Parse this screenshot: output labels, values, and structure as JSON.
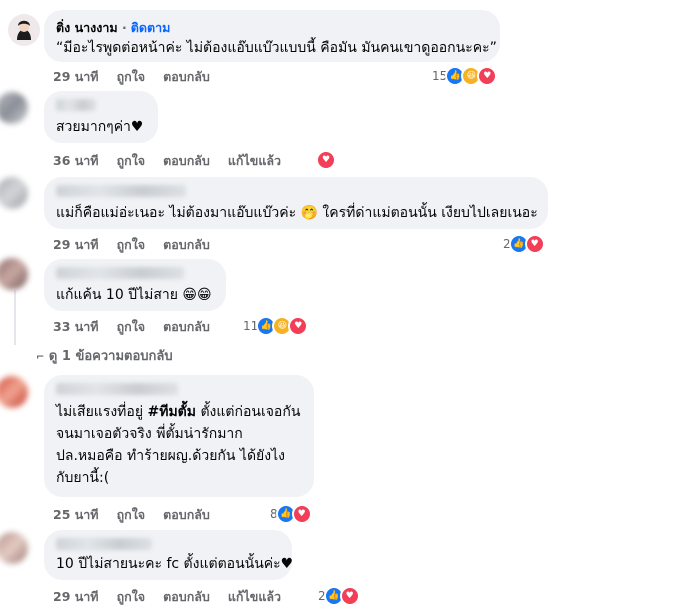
{
  "comments": [
    {
      "author": "ติ่ง นางงาม",
      "follow_label": "ติดตาม",
      "text": [
        "“มีอะไรพูดต่อหน้าค่ะ ไม่ต้องแอ๊บแบ๊วแบบนี้ คือมัน มันคนเขาดูออกนะคะ”"
      ],
      "time": "29 นาที",
      "like_label": "ถูกใจ",
      "reply_label": "ตอบกลับ",
      "reaction_count": "15",
      "reactions": [
        "like-icon",
        "haha-icon",
        "love-icon"
      ]
    },
    {
      "text": [
        "สวยมากๆค่า♥"
      ],
      "time": "36 นาที",
      "like_label": "ถูกใจ",
      "reply_label": "ตอบกลับ",
      "edited_label": "แก้ไขแล้ว",
      "reactions": [
        "love-icon"
      ]
    },
    {
      "text": [
        "แม่ก็คือแม่อ่ะเนอะ ไม่ต้องมาแอ๊บแบ๊วค่ะ 🤭 ใครที่ด่าแม่ตอนนั้น เงียบไปเลยเนอะ"
      ],
      "time": "29 นาที",
      "like_label": "ถูกใจ",
      "reply_label": "ตอบกลับ",
      "reaction_count": "2",
      "reactions": [
        "like-icon",
        "love-icon"
      ]
    },
    {
      "text": [
        "แก้แค้น 10 ปีไม่สาย 😁😁"
      ],
      "time": "33 นาที",
      "like_label": "ถูกใจ",
      "reply_label": "ตอบกลับ",
      "reaction_count": "11",
      "reactions": [
        "like-icon",
        "haha-icon",
        "love-icon"
      ],
      "view_replies": "ดู 1 ข้อความตอบกลับ"
    },
    {
      "text": [
        "ไม่เสียแรงที่อยู่ #ทีมตั้ม ตั้งแต่ก่อนเจอกัน",
        "จนมาเจอตัวจริง พี่ตั้มน่ารักมาก",
        "ปล.หมอคือ ทำร้ายผญ.ด้วยกัน ได้ยังไง",
        "กับยานี้:("
      ],
      "hashtag": "#ทีมตั้ม",
      "time": "25 นาที",
      "like_label": "ถูกใจ",
      "reply_label": "ตอบกลับ",
      "reaction_count": "8",
      "reactions": [
        "like-icon",
        "love-icon"
      ]
    },
    {
      "text": [
        "10 ปีไม่สายนะคะ fc ตั้งแต่ตอนนั้นค่ะ♥"
      ],
      "time": "29 นาที",
      "like_label": "ถูกใจ",
      "reply_label": "ตอบกลับ",
      "edited_label": "แก้ไขแล้ว",
      "reaction_count": "2",
      "reactions": [
        "like-icon",
        "love-icon"
      ]
    }
  ],
  "colors": {
    "bubble": "#f0f2f5",
    "meta": "#65676b",
    "link": "#0866ff",
    "like": "#1877f2",
    "love": "#f33e58",
    "haha": "#f7b125"
  }
}
